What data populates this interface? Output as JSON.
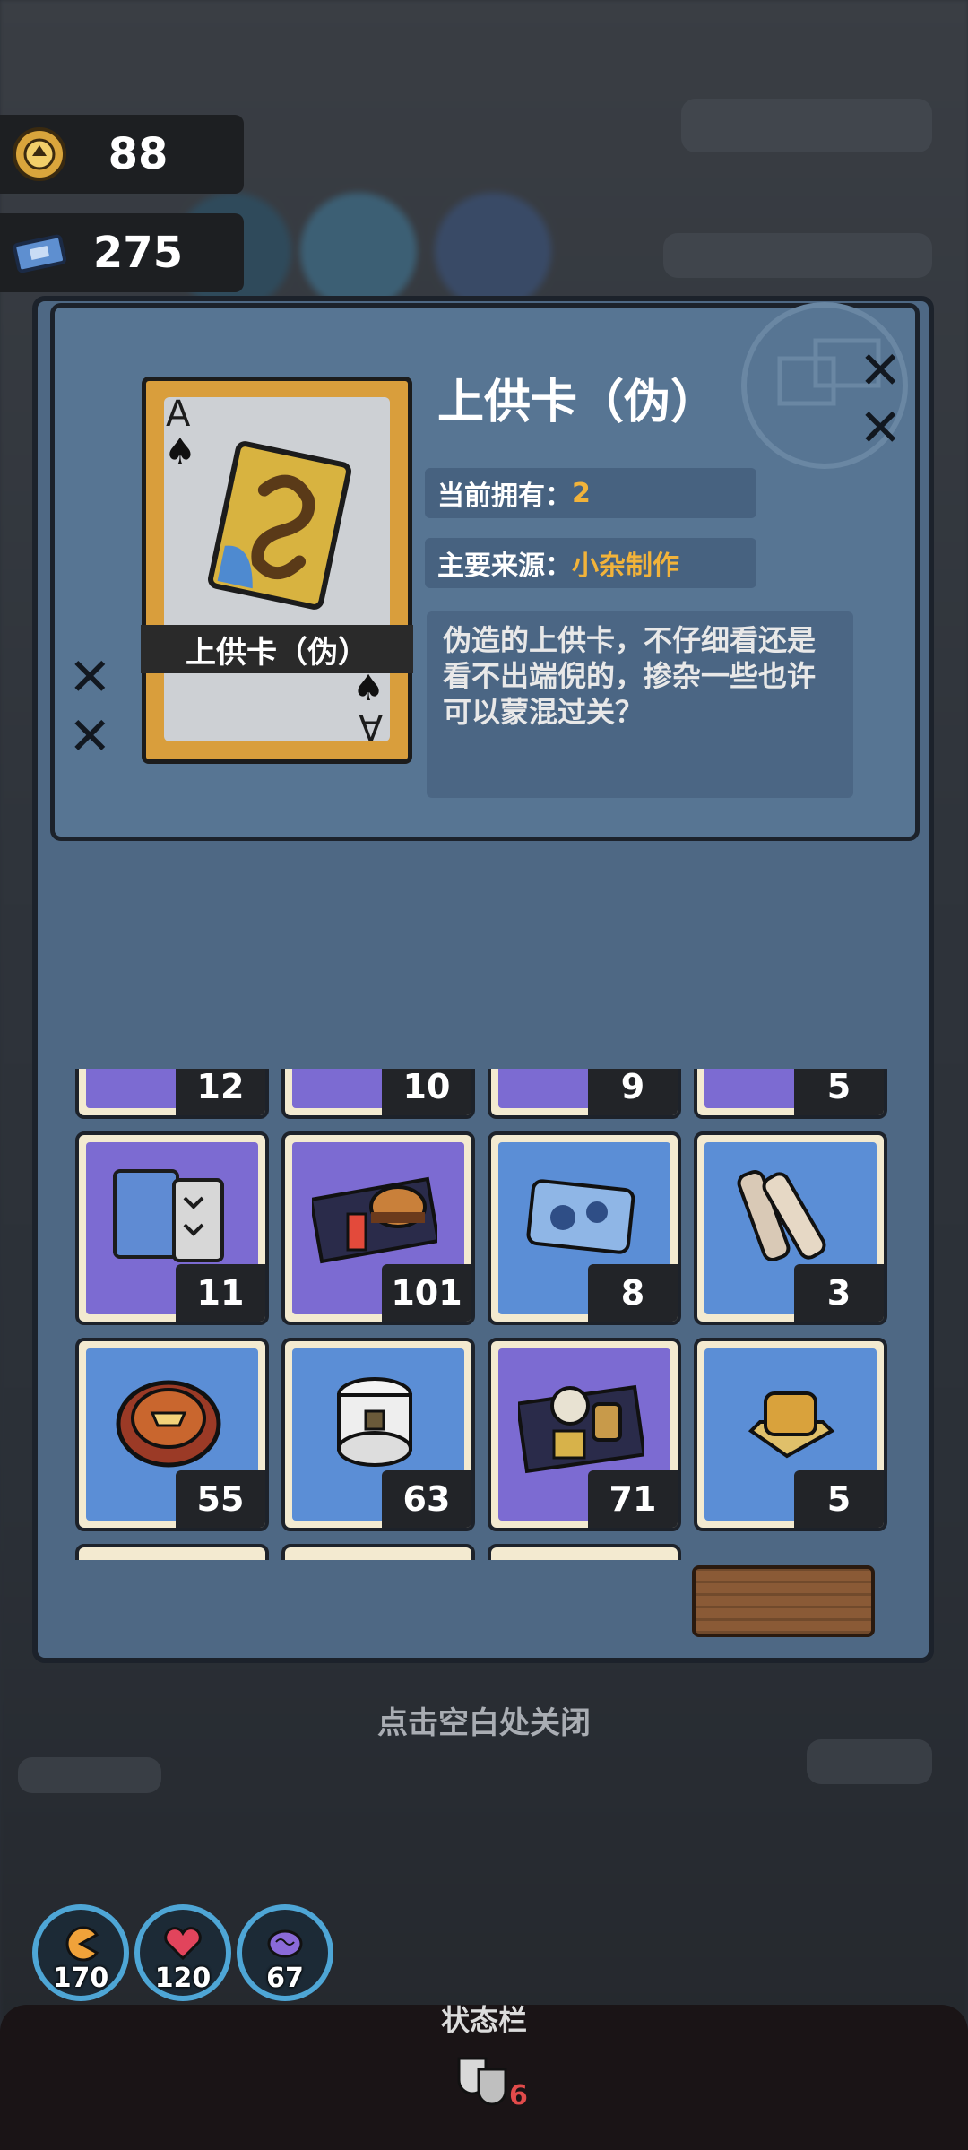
{
  "currencies": [
    {
      "icon": "gold-coin-icon",
      "value": "88"
    },
    {
      "icon": "ticket-icon",
      "value": "275"
    }
  ],
  "item": {
    "title": "上供卡（伪）",
    "card_label": "上供卡（伪）",
    "card_rank": "A",
    "card_suit": "♠",
    "owned_label": "当前拥有：",
    "owned_value": "2",
    "source_label": "主要来源：",
    "source_value": "小杂制作",
    "description": "伪造的上供卡，不仔细看还是看不出端倪的，掺杂一些也许可以蒙混过关？"
  },
  "inventory": {
    "rows": [
      [
        {
          "name": "purple-item-slot",
          "count": "12",
          "color": "#7c6bd2"
        },
        {
          "name": "purple-item-slot",
          "count": "10",
          "color": "#7c6bd2"
        },
        {
          "name": "purple-item-slot",
          "count": "9",
          "color": "#7c6bd2"
        },
        {
          "name": "purple-item-slot",
          "count": "5",
          "color": "#7c6bd2"
        }
      ],
      [
        {
          "name": "map-and-tablet-item",
          "count": "11",
          "color": "#7c6bd2"
        },
        {
          "name": "burger-meal-item",
          "count": "101",
          "color": "#7c6bd2"
        },
        {
          "name": "frozen-food-item",
          "count": "8",
          "color": "#5b8ed6"
        },
        {
          "name": "bandage-roll-item",
          "count": "3",
          "color": "#5b8ed6"
        }
      ],
      [
        {
          "name": "badge-item",
          "count": "55",
          "color": "#5b8ed6"
        },
        {
          "name": "toilet-paper-item",
          "count": "63",
          "color": "#5b8ed6"
        },
        {
          "name": "bun-meal-item",
          "count": "71",
          "color": "#7c6bd2"
        },
        {
          "name": "cake-item",
          "count": "5",
          "color": "#5b8ed6"
        }
      ]
    ]
  },
  "close_hint": "点击空白处关闭",
  "stats": [
    {
      "icon": "hunger-icon",
      "value": "170",
      "color": "#f0a23a"
    },
    {
      "icon": "heart-icon",
      "value": "120",
      "color": "#e2445c"
    },
    {
      "icon": "brain-icon",
      "value": "67",
      "color": "#8a6ad8"
    }
  ],
  "statusbar": {
    "label": "状态栏",
    "mask_icon": "theater-masks-icon",
    "mask_count": "6"
  }
}
